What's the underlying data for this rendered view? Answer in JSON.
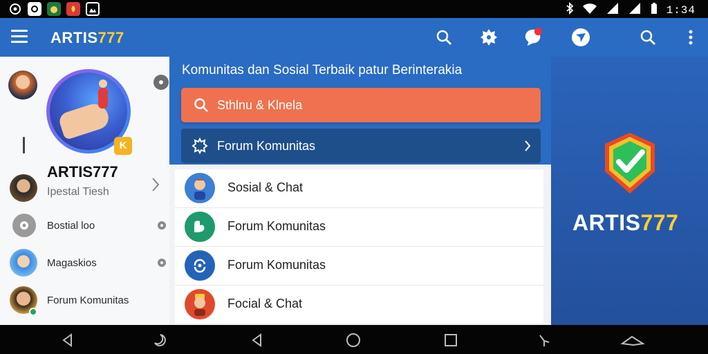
{
  "status_bar": {
    "time": "1:34",
    "icons": [
      "game-controller-icon",
      "camera-icon",
      "cat-app-icon",
      "fire-app-icon",
      "gallery-icon",
      "bluetooth-icon",
      "wifi-icon",
      "signal-icon",
      "signal-icon-2",
      "battery-icon"
    ]
  },
  "app_bar": {
    "title_main": "ARTIS",
    "title_accent": "777",
    "icons": [
      "search-icon",
      "settings-gear-icon",
      "chat-notification-icon",
      "navigation-icon",
      "search-icon-2",
      "overflow-menu-icon"
    ]
  },
  "drawer": {
    "profile_name": "ARTIS777",
    "profile_sub": "Ipestal Tiesh",
    "badge_letter": "K",
    "items": [
      {
        "label": "Bostial loo"
      },
      {
        "label": "Magaskios"
      },
      {
        "label": "Forum Komunitas"
      }
    ]
  },
  "main": {
    "tagline": "Komunitas dan Sosial Terbaik patur Berinterakia",
    "search_label": "Sthlnu & Klnela",
    "forum_label": "Forum Komunitas",
    "list": [
      {
        "label": "Sosial & Chat",
        "color": "#3b7fd6"
      },
      {
        "label": "Forum Komunitas",
        "color": "#1f9a6c"
      },
      {
        "label": "Forum Komunitas",
        "color": "#2563b8"
      },
      {
        "label": "Focial & Chat",
        "color": "#e04a2c"
      }
    ]
  },
  "brand_panel": {
    "brand_main": "ARTIS",
    "brand_accent": "777"
  },
  "colors": {
    "primary": "#2a6bc4",
    "accent_orange": "#f0714f",
    "dark_blue": "#1f4f8a",
    "gold": "#ffcf33"
  }
}
